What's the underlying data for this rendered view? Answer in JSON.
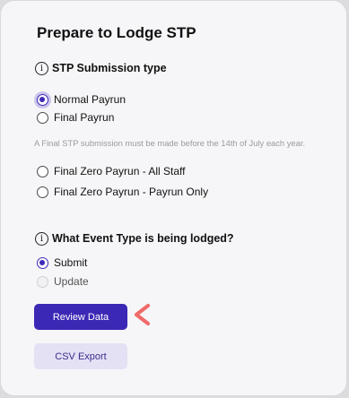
{
  "page": {
    "title": "Prepare to Lodge STP"
  },
  "stp_section": {
    "label": "STP Submission type",
    "info_icon": "i",
    "options": [
      {
        "label": "Normal Payrun",
        "selected": true
      },
      {
        "label": "Final Payrun",
        "selected": false
      },
      {
        "label": "Final Zero Payrun - All Staff",
        "selected": false
      },
      {
        "label": "Final Zero Payrun - Payrun Only",
        "selected": false
      }
    ],
    "note": "A Final STP submission must be made before the 14th of July each year."
  },
  "event_section": {
    "label": "What Event Type is being lodged?",
    "info_icon": "i",
    "options": [
      {
        "label": "Submit",
        "selected": true,
        "disabled": false
      },
      {
        "label": "Update",
        "selected": false,
        "disabled": true
      }
    ]
  },
  "actions": {
    "review_label": "Review Data",
    "csv_label": "CSV Export"
  },
  "colors": {
    "accent": "#3b28b5",
    "secondary_button_bg": "#e4e1f5",
    "pointer": "#f06a6a"
  },
  "icons": {
    "info": "info-circle-icon",
    "pointer": "chevron-left-icon"
  }
}
